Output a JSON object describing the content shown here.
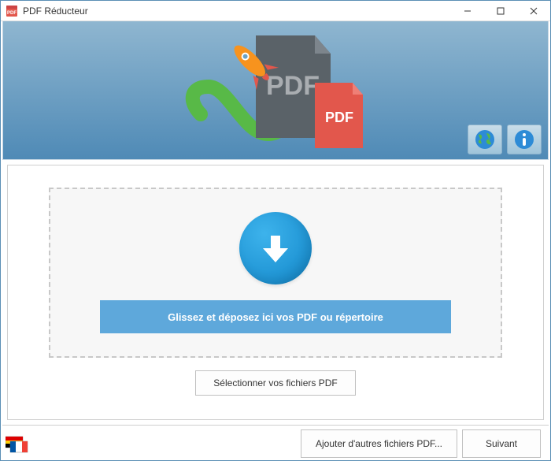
{
  "window": {
    "title": "PDF Réducteur"
  },
  "banner": {
    "pdf_label_large": "PDF",
    "pdf_label_small": "PDF"
  },
  "dropzone": {
    "message": "Glissez et déposez ici vos PDF ou répertoire"
  },
  "buttons": {
    "select_files": "Sélectionner vos fichiers PDF",
    "add_more": "Ajouter d'autres fichiers PDF...",
    "next": "Suivant"
  },
  "icons": {
    "globe": "globe-icon",
    "info": "info-icon",
    "language": "language-icon"
  },
  "colors": {
    "banner_top": "#8fb6d0",
    "banner_bottom": "#4f8ab6",
    "accent_blue": "#5ea8db",
    "drop_circle": "#1e93d3",
    "pdf_red": "#e2574c",
    "green": "#58b947",
    "orange": "#f7931e",
    "dark_pdf": "#5a6268"
  }
}
